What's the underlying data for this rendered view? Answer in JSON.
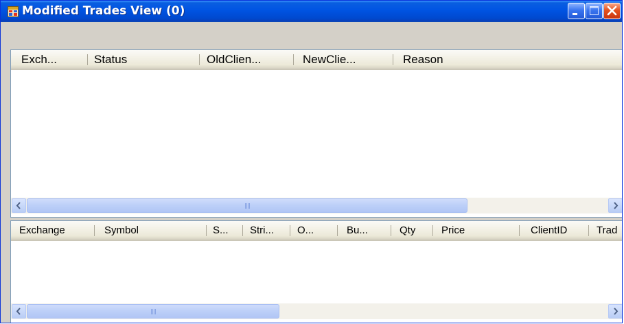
{
  "window": {
    "title": "Modified Trades View (0)"
  },
  "top_grid": {
    "columns": [
      "Exch...",
      "Status",
      "OldClien...",
      "NewClie...",
      "Reason"
    ],
    "rows": []
  },
  "bottom_grid": {
    "columns": [
      "Exchange",
      "Symbol",
      "S...",
      "Stri...",
      "O...",
      "Bu...",
      "Qty",
      "Price",
      "ClientID",
      "Trad"
    ],
    "rows": []
  },
  "colors": {
    "titlebar": "#0054e3",
    "close_button": "#e5521f",
    "header_bg": "#ece9d8",
    "scroll_thumb": "#bccff8"
  },
  "icons": {
    "app": "app-window-icon",
    "minimize": "minimize-icon",
    "maximize": "maximize-icon",
    "close": "close-icon"
  }
}
